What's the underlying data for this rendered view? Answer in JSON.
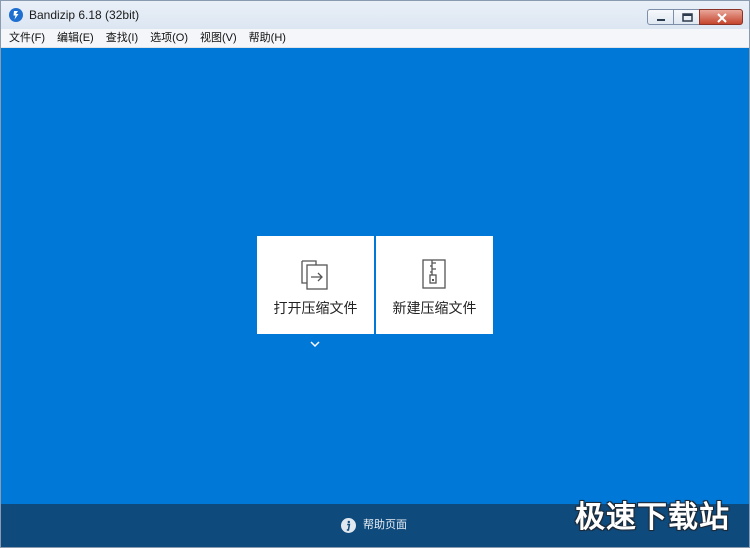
{
  "window": {
    "title": "Bandizip 6.18 (32bit)",
    "app_icon": "bandizip-app-icon"
  },
  "menu": {
    "items": [
      {
        "label": "文件(F)"
      },
      {
        "label": "编辑(E)"
      },
      {
        "label": "查找(I)"
      },
      {
        "label": "选项(O)"
      },
      {
        "label": "视图(V)"
      },
      {
        "label": "帮助(H)"
      }
    ]
  },
  "main": {
    "background_color": "#0078d7",
    "tiles": [
      {
        "label": "打开压缩文件",
        "icon": "open-archive-icon"
      },
      {
        "label": "新建压缩文件",
        "icon": "new-archive-icon"
      }
    ]
  },
  "footer": {
    "background_color": "#0f4a7c",
    "help_label": "帮助页面",
    "help_icon": "info-icon"
  },
  "watermark": {
    "text": "极速下载站"
  }
}
